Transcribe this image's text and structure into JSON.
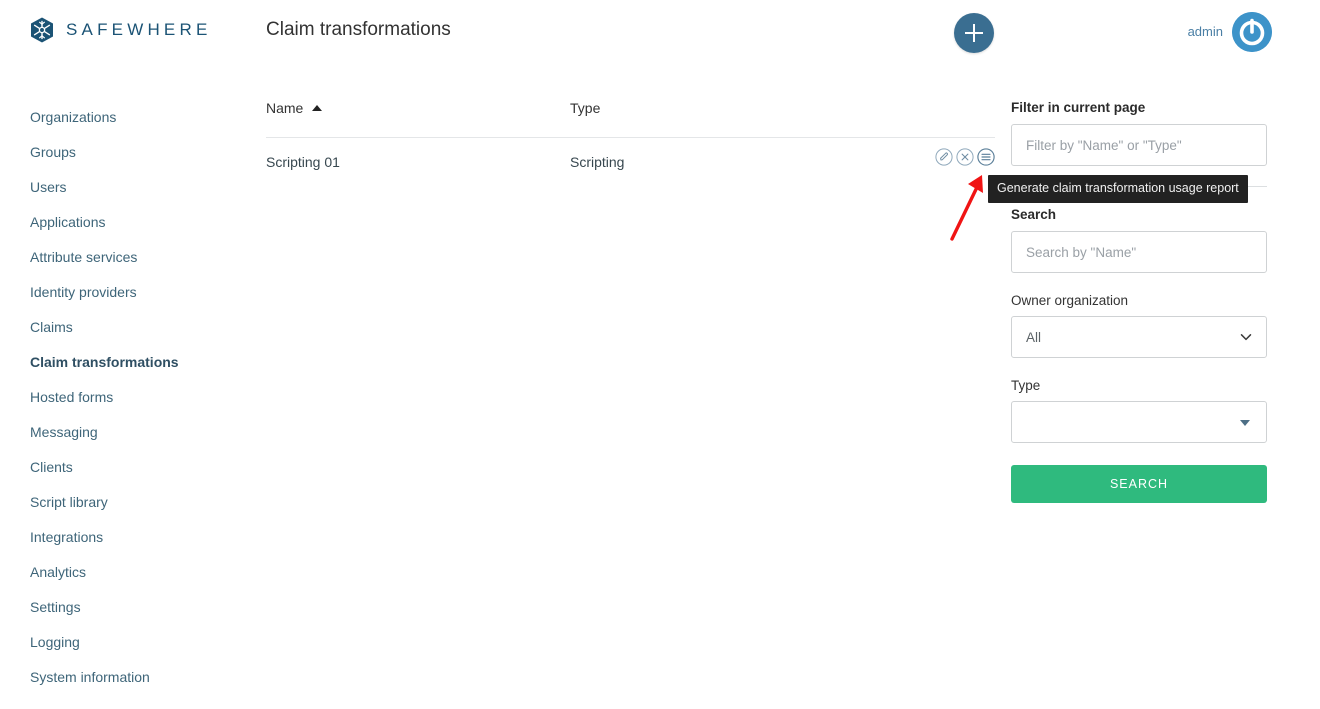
{
  "brand": {
    "name": "SAFEWHERE",
    "logo_icon": "snowflake-hexagon-icon",
    "color": "#1b5375"
  },
  "header": {
    "title": "Claim transformations",
    "add_button_icon": "plus-icon",
    "add_button_color": "#3a6e91",
    "user_name": "admin",
    "avatar_icon": "power-icon",
    "avatar_color": "#3d93c9"
  },
  "sidebar": {
    "items": [
      {
        "label": "Organizations",
        "active": false
      },
      {
        "label": "Groups",
        "active": false
      },
      {
        "label": "Users",
        "active": false
      },
      {
        "label": "Applications",
        "active": false
      },
      {
        "label": "Attribute services",
        "active": false
      },
      {
        "label": "Identity providers",
        "active": false
      },
      {
        "label": "Claims",
        "active": false
      },
      {
        "label": "Claim transformations",
        "active": true
      },
      {
        "label": "Hosted forms",
        "active": false
      },
      {
        "label": "Messaging",
        "active": false
      },
      {
        "label": "Clients",
        "active": false
      },
      {
        "label": "Script library",
        "active": false
      },
      {
        "label": "Integrations",
        "active": false
      },
      {
        "label": "Analytics",
        "active": false
      },
      {
        "label": "Settings",
        "active": false
      },
      {
        "label": "Logging",
        "active": false
      },
      {
        "label": "System information",
        "active": false
      }
    ]
  },
  "table": {
    "columns": [
      {
        "label": "Name",
        "sort": "asc",
        "sort_icon": "triangle-up-icon"
      },
      {
        "label": "Type",
        "sort": "none"
      }
    ],
    "rows": [
      {
        "name": "Scripting 01",
        "type": "Scripting",
        "actions": [
          {
            "icon": "edit-pencil-icon",
            "title": "Edit"
          },
          {
            "icon": "delete-x-icon",
            "title": "Delete"
          },
          {
            "icon": "report-list-icon",
            "title": "Generate claim transformation usage report"
          }
        ]
      }
    ]
  },
  "tooltip": {
    "text": "Generate claim transformation usage report",
    "background": "#222222"
  },
  "annotation": {
    "arrow_color": "#f01414",
    "arrow_icon": "red-arrow-up-right-icon"
  },
  "filters": {
    "filter_section_label": "Filter in current page",
    "filter_input_placeholder": "Filter by \"Name\" or \"Type\"",
    "filter_input_value": "",
    "search_section_label": "Search",
    "search_input_placeholder": "Search by \"Name\"",
    "search_input_value": "",
    "owner_org_label": "Owner organization",
    "owner_org_value": "All",
    "owner_org_options": [
      "All"
    ],
    "owner_org_icon": "chevron-down-icon",
    "type_label": "Type",
    "type_value": "",
    "type_icon": "caret-down-icon",
    "search_button_label": "SEARCH",
    "search_button_color": "#2fba7e"
  }
}
